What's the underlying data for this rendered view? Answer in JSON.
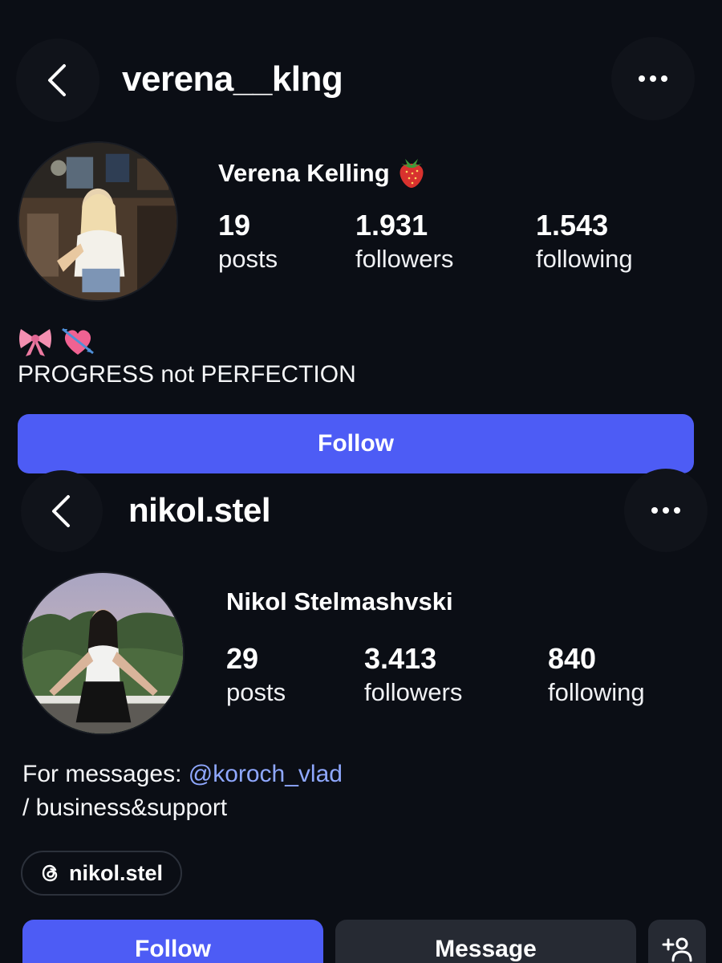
{
  "profile1": {
    "username": "verena__klng",
    "display_name": "Verena Kelling",
    "name_emoji": "strawberry",
    "posts_count": "19",
    "posts_label": "posts",
    "followers_count": "1.931",
    "followers_label": "followers",
    "following_count": "1.543",
    "following_label": "following",
    "bio_emojis": [
      "ribbon",
      "heart-with-arrow"
    ],
    "bio_text": "PROGRESS not PERFECTION",
    "follow_label": "Follow"
  },
  "profile2": {
    "username": "nikol.stel",
    "display_name": "Nikol Stelmashvski",
    "posts_count": "29",
    "posts_label": "posts",
    "followers_count": "3.413",
    "followers_label": "followers",
    "following_count": "840",
    "following_label": "following",
    "bio_prefix": "For messages: ",
    "bio_mention": "@koroch_vlad",
    "bio_line2": "/ business&support",
    "threads_handle": "nikol.stel",
    "follow_label": "Follow",
    "message_label": "Message"
  },
  "colors": {
    "background": "#0b0e15",
    "primary_button": "#4d5cf5",
    "secondary_button": "#262a33",
    "mention_link": "#8fa8ff"
  }
}
